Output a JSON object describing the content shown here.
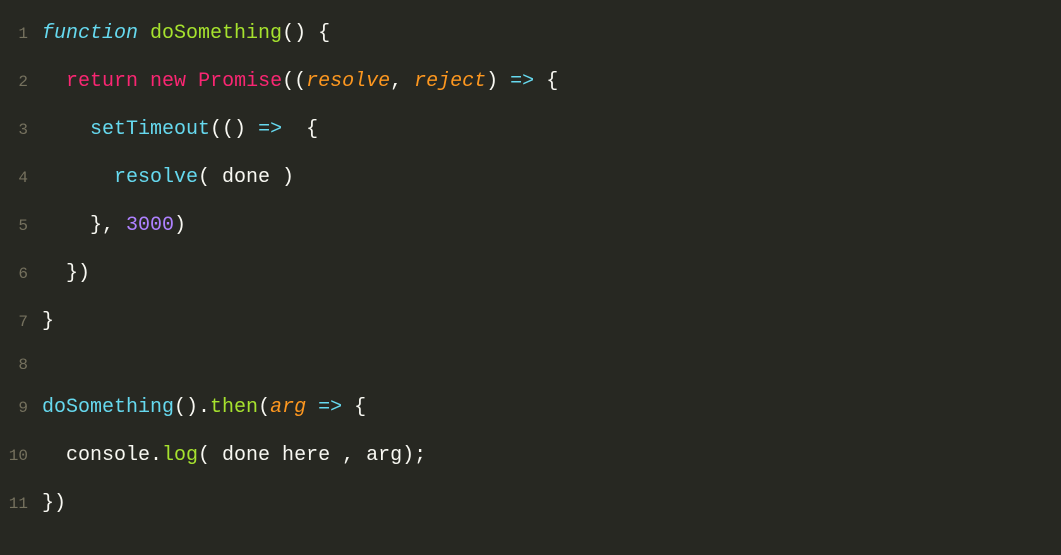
{
  "lines": [
    {
      "num": "1",
      "tokens": [
        {
          "cls": "tok-keyword",
          "text": "function"
        },
        {
          "cls": "tok-plain",
          "text": " "
        },
        {
          "cls": "tok-funcname",
          "text": "doSomething"
        },
        {
          "cls": "tok-plain",
          "text": "() {"
        }
      ]
    },
    {
      "num": "2",
      "tokens": [
        {
          "cls": "tok-plain",
          "text": "  "
        },
        {
          "cls": "tok-keyword2",
          "text": "return"
        },
        {
          "cls": "tok-plain",
          "text": " "
        },
        {
          "cls": "tok-keyword2",
          "text": "new"
        },
        {
          "cls": "tok-plain",
          "text": " "
        },
        {
          "cls": "tok-class",
          "text": "Promise"
        },
        {
          "cls": "tok-plain",
          "text": "(("
        },
        {
          "cls": "tok-param",
          "text": "resolve"
        },
        {
          "cls": "tok-plain",
          "text": ", "
        },
        {
          "cls": "tok-param",
          "text": "reject"
        },
        {
          "cls": "tok-plain",
          "text": ") "
        },
        {
          "cls": "tok-keyword",
          "text": "=>"
        },
        {
          "cls": "tok-plain",
          "text": " {"
        }
      ]
    },
    {
      "num": "3",
      "tokens": [
        {
          "cls": "tok-plain",
          "text": "    "
        },
        {
          "cls": "tok-call",
          "text": "setTimeout"
        },
        {
          "cls": "tok-plain",
          "text": "(() "
        },
        {
          "cls": "tok-keyword",
          "text": "=>"
        },
        {
          "cls": "tok-plain",
          "text": "  {"
        }
      ]
    },
    {
      "num": "4",
      "tokens": [
        {
          "cls": "tok-plain",
          "text": "      "
        },
        {
          "cls": "tok-call",
          "text": "resolve"
        },
        {
          "cls": "tok-plain",
          "text": "( done )"
        }
      ]
    },
    {
      "num": "5",
      "tokens": [
        {
          "cls": "tok-plain",
          "text": "    }, "
        },
        {
          "cls": "tok-number",
          "text": "3000"
        },
        {
          "cls": "tok-plain",
          "text": ")"
        }
      ]
    },
    {
      "num": "6",
      "tokens": [
        {
          "cls": "tok-plain",
          "text": "  })"
        }
      ]
    },
    {
      "num": "7",
      "tokens": [
        {
          "cls": "tok-plain",
          "text": "}"
        }
      ]
    },
    {
      "num": "8",
      "tokens": [
        {
          "cls": "tok-plain",
          "text": ""
        }
      ]
    },
    {
      "num": "9",
      "tokens": [
        {
          "cls": "tok-call",
          "text": "doSomething"
        },
        {
          "cls": "tok-plain",
          "text": "()."
        },
        {
          "cls": "tok-method",
          "text": "then"
        },
        {
          "cls": "tok-plain",
          "text": "("
        },
        {
          "cls": "tok-param",
          "text": "arg"
        },
        {
          "cls": "tok-plain",
          "text": " "
        },
        {
          "cls": "tok-keyword",
          "text": "=>"
        },
        {
          "cls": "tok-plain",
          "text": " {"
        }
      ]
    },
    {
      "num": "10",
      "tokens": [
        {
          "cls": "tok-plain",
          "text": "  console."
        },
        {
          "cls": "tok-method",
          "text": "log"
        },
        {
          "cls": "tok-plain",
          "text": "( done here , arg);"
        }
      ]
    },
    {
      "num": "11",
      "tokens": [
        {
          "cls": "tok-plain",
          "text": "})"
        }
      ]
    }
  ]
}
